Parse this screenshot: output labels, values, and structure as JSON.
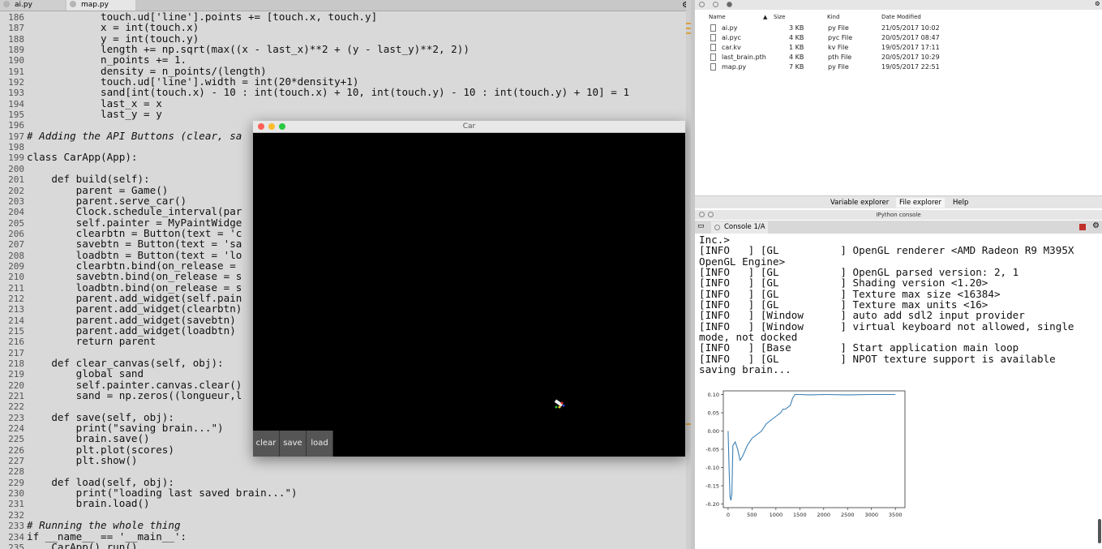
{
  "editor": {
    "tabs": [
      "ai.py",
      "map.py"
    ],
    "lines": [
      {
        "n": "186",
        "t": "            touch.ud['line'].points += [touch.x, touch.y]"
      },
      {
        "n": "187",
        "t": "            x = int(touch.x)"
      },
      {
        "n": "188",
        "t": "            y = int(touch.y)"
      },
      {
        "n": "189",
        "t": "            length += np.sqrt(max((x - last_x)**2 + (y - last_y)**2, 2))"
      },
      {
        "n": "190",
        "t": "            n_points += 1."
      },
      {
        "n": "191",
        "t": "            density = n_points/(length)"
      },
      {
        "n": "192",
        "t": "            touch.ud['line'].width = int(20*density+1)"
      },
      {
        "n": "193",
        "t": "            sand[int(touch.x) - 10 : int(touch.x) + 10, int(touch.y) - 10 : int(touch.y) + 10] = 1"
      },
      {
        "n": "194",
        "t": "            last_x = x"
      },
      {
        "n": "195",
        "t": "            last_y = y"
      },
      {
        "n": "196",
        "t": ""
      },
      {
        "n": "197",
        "t": "# Adding the API Buttons (clear, sa"
      },
      {
        "n": "198",
        "t": ""
      },
      {
        "n": "199",
        "t": "class CarApp(App):"
      },
      {
        "n": "200",
        "t": ""
      },
      {
        "n": "201",
        "t": "    def build(self):"
      },
      {
        "n": "202",
        "t": "        parent = Game()"
      },
      {
        "n": "203",
        "t": "        parent.serve_car()"
      },
      {
        "n": "204",
        "t": "        Clock.schedule_interval(par"
      },
      {
        "n": "205",
        "t": "        self.painter = MyPaintWidge"
      },
      {
        "n": "206",
        "t": "        clearbtn = Button(text = 'c"
      },
      {
        "n": "207",
        "t": "        savebtn = Button(text = 'sa"
      },
      {
        "n": "208",
        "t": "        loadbtn = Button(text = 'lo"
      },
      {
        "n": "209",
        "t": "        clearbtn.bind(on_release = "
      },
      {
        "n": "210",
        "t": "        savebtn.bind(on_release = s"
      },
      {
        "n": "211",
        "t": "        loadbtn.bind(on_release = s"
      },
      {
        "n": "212",
        "t": "        parent.add_widget(self.pain"
      },
      {
        "n": "213",
        "t": "        parent.add_widget(clearbtn)"
      },
      {
        "n": "214",
        "t": "        parent.add_widget(savebtn)"
      },
      {
        "n": "215",
        "t": "        parent.add_widget(loadbtn)"
      },
      {
        "n": "216",
        "t": "        return parent"
      },
      {
        "n": "217",
        "t": ""
      },
      {
        "n": "218",
        "t": "    def clear_canvas(self, obj):"
      },
      {
        "n": "219",
        "t": "        global sand"
      },
      {
        "n": "220",
        "t": "        self.painter.canvas.clear()"
      },
      {
        "n": "221",
        "t": "        sand = np.zeros((longueur,l"
      },
      {
        "n": "222",
        "t": ""
      },
      {
        "n": "223",
        "t": "    def save(self, obj):"
      },
      {
        "n": "224",
        "t": "        print(\"saving brain...\")"
      },
      {
        "n": "225",
        "t": "        brain.save()"
      },
      {
        "n": "226",
        "t": "        plt.plot(scores)"
      },
      {
        "n": "227",
        "t": "        plt.show()"
      },
      {
        "n": "228",
        "t": ""
      },
      {
        "n": "229",
        "t": "    def load(self, obj):"
      },
      {
        "n": "230",
        "t": "        print(\"loading last saved brain...\")"
      },
      {
        "n": "231",
        "t": "        brain.load()"
      },
      {
        "n": "232",
        "t": ""
      },
      {
        "n": "233",
        "t": "# Running the whole thing"
      },
      {
        "n": "234",
        "t": "if __name__ == '__main__':"
      },
      {
        "n": "235",
        "t": "    CarApp().run()"
      }
    ]
  },
  "car_window": {
    "title": "Car",
    "buttons": [
      "clear",
      "save",
      "load"
    ]
  },
  "file_explorer": {
    "columns": {
      "name": "Name",
      "size": "Size",
      "kind": "Kind",
      "date": "Date Modified"
    },
    "files": [
      {
        "name": "ai.py",
        "size": "3 KB",
        "kind": "py File",
        "date": "21/05/2017 10:02"
      },
      {
        "name": "ai.pyc",
        "size": "4 KB",
        "kind": "pyc File",
        "date": "20/05/2017 08:47"
      },
      {
        "name": "car.kv",
        "size": "1 KB",
        "kind": "kv File",
        "date": "19/05/2017 17:11"
      },
      {
        "name": "last_brain.pth",
        "size": "4 KB",
        "kind": "pth File",
        "date": "20/05/2017 10:29"
      },
      {
        "name": "map.py",
        "size": "7 KB",
        "kind": "py File",
        "date": "19/05/2017 22:51"
      }
    ]
  },
  "pane_tabs": [
    "Variable explorer",
    "File explorer",
    "Help"
  ],
  "ipython": {
    "title": "IPython console",
    "tab": "Console 1/A",
    "lines": [
      "Inc.>",
      "[INFO   ] [GL          ] OpenGL renderer <AMD Radeon R9 M395X",
      "OpenGL Engine>",
      "[INFO   ] [GL          ] OpenGL parsed version: 2, 1",
      "[INFO   ] [GL          ] Shading version <1.20>",
      "[INFO   ] [GL          ] Texture max size <16384>",
      "[INFO   ] [GL          ] Texture max units <16>",
      "[INFO   ] [Window      ] auto add sdl2 input provider",
      "[INFO   ] [Window      ] virtual keyboard not allowed, single",
      "mode, not docked",
      "[INFO   ] [Base        ] Start application main loop",
      "[INFO   ] [GL          ] NPOT texture support is available",
      "saving brain..."
    ]
  },
  "chart_data": {
    "type": "line",
    "xlim": [
      -100,
      3700
    ],
    "ylim": [
      -0.21,
      0.11
    ],
    "xticks": [
      "0",
      "500",
      "1000",
      "1500",
      "2000",
      "2500",
      "3000",
      "3500"
    ],
    "yticks": [
      "0.10",
      "0.05",
      "0.00",
      "-0.05",
      "-0.10",
      "-0.15",
      "-0.20"
    ],
    "color": "#3a7fb5",
    "x": [
      0,
      20,
      40,
      60,
      80,
      100,
      150,
      200,
      250,
      300,
      400,
      500,
      600,
      700,
      800,
      900,
      1000,
      1100,
      1150,
      1200,
      1300,
      1350,
      1400,
      1500,
      1700,
      2000,
      2500,
      3000,
      3500
    ],
    "y": [
      0.0,
      -0.1,
      -0.18,
      -0.19,
      -0.17,
      -0.04,
      -0.03,
      -0.05,
      -0.08,
      -0.07,
      -0.04,
      -0.02,
      -0.01,
      0.0,
      0.02,
      0.03,
      0.04,
      0.05,
      0.06,
      0.06,
      0.07,
      0.09,
      0.1,
      0.1,
      0.099,
      0.1,
      0.099,
      0.1,
      0.1
    ]
  }
}
